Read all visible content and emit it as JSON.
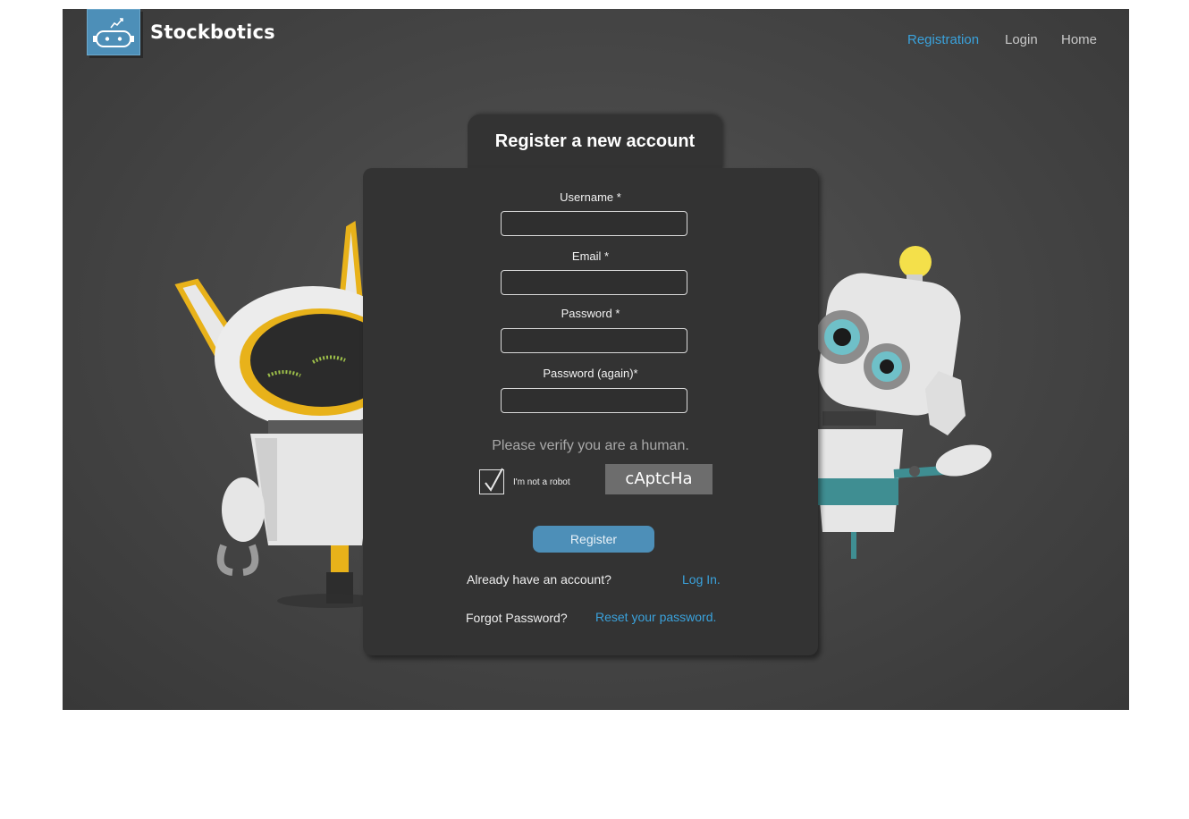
{
  "header": {
    "brand": "Stockbotics",
    "logo_icon": "robot-chart-icon",
    "nav": [
      {
        "label": "Registration",
        "active": true
      },
      {
        "label": "Login",
        "active": false
      },
      {
        "label": "Home",
        "active": false
      }
    ]
  },
  "form": {
    "title": "Register a new account",
    "fields": [
      {
        "label": "Username *",
        "value": ""
      },
      {
        "label": "Email *",
        "value": ""
      },
      {
        "label": "Password *",
        "value": ""
      },
      {
        "label": "Password (again)*",
        "value": ""
      }
    ],
    "captcha": {
      "prompt": "Please verify you are a human.",
      "checkbox_label": "I'm not a robot",
      "checked": true,
      "code": "cAptcHa"
    },
    "submit_label": "Register",
    "login_question": "Already have an account?",
    "login_link": "Log In.",
    "forgot_question": "Forgot Password?",
    "reset_link": "Reset your password."
  },
  "colors": {
    "accent": "#3aa2dc",
    "logo_bg": "#4d8fb8",
    "card_bg": "#333333",
    "stage_bg": "#474747"
  }
}
